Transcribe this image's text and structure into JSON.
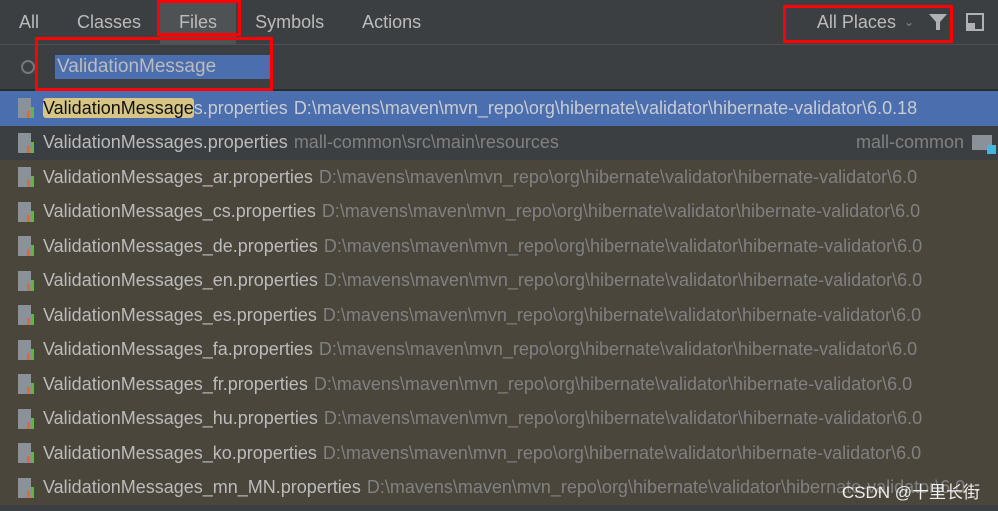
{
  "tabs": [
    {
      "label": "All"
    },
    {
      "label": "Classes"
    },
    {
      "label": "Files",
      "active": true
    },
    {
      "label": "Symbols"
    },
    {
      "label": "Actions"
    }
  ],
  "scope": {
    "label": "All Places",
    "icons": [
      "chevron-down-icon",
      "filter-icon",
      "pin-window-icon"
    ]
  },
  "search": {
    "value": "ValidationMessage"
  },
  "results": [
    {
      "match": "ValidationMessage",
      "rest": "s.properties",
      "path": "D:\\mavens\\maven\\mvn_repo\\org\\hibernate\\validator\\hibernate-validator\\6.0.18"
    },
    {
      "match": "ValidationMessages.properties",
      "rest": "",
      "path": "mall-common\\src\\main\\resources",
      "module": "mall-common"
    },
    {
      "match": "ValidationMessages_ar.properties",
      "rest": "",
      "path": "D:\\mavens\\maven\\mvn_repo\\org\\hibernate\\validator\\hibernate-validator\\6.0"
    },
    {
      "match": "ValidationMessages_cs.properties",
      "rest": "",
      "path": "D:\\mavens\\maven\\mvn_repo\\org\\hibernate\\validator\\hibernate-validator\\6.0"
    },
    {
      "match": "ValidationMessages_de.properties",
      "rest": "",
      "path": "D:\\mavens\\maven\\mvn_repo\\org\\hibernate\\validator\\hibernate-validator\\6.0"
    },
    {
      "match": "ValidationMessages_en.properties",
      "rest": "",
      "path": "D:\\mavens\\maven\\mvn_repo\\org\\hibernate\\validator\\hibernate-validator\\6.0"
    },
    {
      "match": "ValidationMessages_es.properties",
      "rest": "",
      "path": "D:\\mavens\\maven\\mvn_repo\\org\\hibernate\\validator\\hibernate-validator\\6.0"
    },
    {
      "match": "ValidationMessages_fa.properties",
      "rest": "",
      "path": "D:\\mavens\\maven\\mvn_repo\\org\\hibernate\\validator\\hibernate-validator\\6.0"
    },
    {
      "match": "ValidationMessages_fr.properties",
      "rest": "",
      "path": "D:\\mavens\\maven\\mvn_repo\\org\\hibernate\\validator\\hibernate-validator\\6.0"
    },
    {
      "match": "ValidationMessages_hu.properties",
      "rest": "",
      "path": "D:\\mavens\\maven\\mvn_repo\\org\\hibernate\\validator\\hibernate-validator\\6.0"
    },
    {
      "match": "ValidationMessages_ko.properties",
      "rest": "",
      "path": "D:\\mavens\\maven\\mvn_repo\\org\\hibernate\\validator\\hibernate-validator\\6.0"
    },
    {
      "match": "ValidationMessages_mn_MN.properties",
      "rest": "",
      "path": "D:\\mavens\\maven\\mvn_repo\\org\\hibernate\\validator\\hibernate-validator\\6.0"
    }
  ],
  "watermark": "CSDN @十里长街",
  "colors": {
    "selection": "#4b6eaf",
    "highlight": "#d7c586",
    "library_row": "#4a463c",
    "annotation": "#ff0000"
  }
}
